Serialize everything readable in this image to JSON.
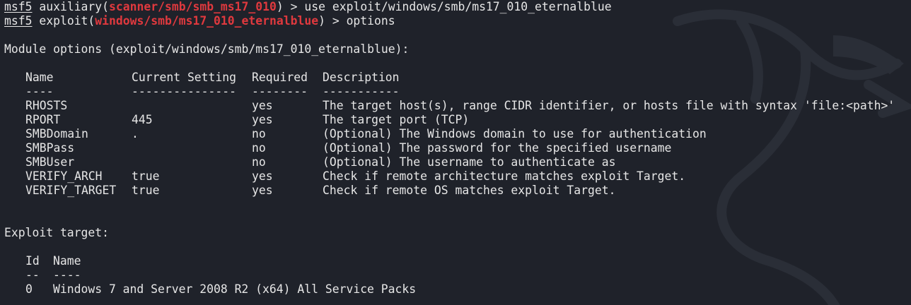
{
  "prompt1": {
    "msf": "msf5",
    "before_module": " auxiliary(",
    "module": "scanner/smb/smb_ms17_010",
    "after_module": ") > ",
    "command": "use exploit/windows/smb/ms17_010_eternalblue"
  },
  "prompt2": {
    "msf": "msf5",
    "before_module": " exploit(",
    "module": "windows/smb/ms17_010_eternalblue",
    "after_module": ") > ",
    "command": "options"
  },
  "module_options_header": "Module options (exploit/windows/smb/ms17_010_eternalblue):",
  "options_table": {
    "headers": [
      "Name",
      "Current Setting",
      "Required",
      "Description"
    ],
    "underlines": [
      "----",
      "---------------",
      "--------",
      "-----------"
    ],
    "rows": [
      {
        "name": "RHOSTS",
        "setting": "",
        "required": "yes",
        "description": "The target host(s), range CIDR identifier, or hosts file with syntax 'file:<path>'"
      },
      {
        "name": "RPORT",
        "setting": "445",
        "required": "yes",
        "description": "The target port (TCP)"
      },
      {
        "name": "SMBDomain",
        "setting": ".",
        "required": "no",
        "description": "(Optional) The Windows domain to use for authentication"
      },
      {
        "name": "SMBPass",
        "setting": "",
        "required": "no",
        "description": "(Optional) The password for the specified username"
      },
      {
        "name": "SMBUser",
        "setting": "",
        "required": "no",
        "description": "(Optional) The username to authenticate as"
      },
      {
        "name": "VERIFY_ARCH",
        "setting": "true",
        "required": "yes",
        "description": "Check if remote architecture matches exploit Target."
      },
      {
        "name": "VERIFY_TARGET",
        "setting": "true",
        "required": "yes",
        "description": "Check if remote OS matches exploit Target."
      }
    ]
  },
  "exploit_target_header": "Exploit target:",
  "target_table": {
    "headers": [
      "Id",
      "Name"
    ],
    "underlines": [
      "--",
      "----"
    ],
    "rows": [
      {
        "id": "0",
        "name": "Windows 7 and Server 2008 R2 (x64) All Service Packs"
      }
    ]
  },
  "colors": {
    "background": "#1f222a",
    "text": "#e6e6e6",
    "module_red": "#e0393e"
  },
  "background_art": "kali-dragon-icon"
}
